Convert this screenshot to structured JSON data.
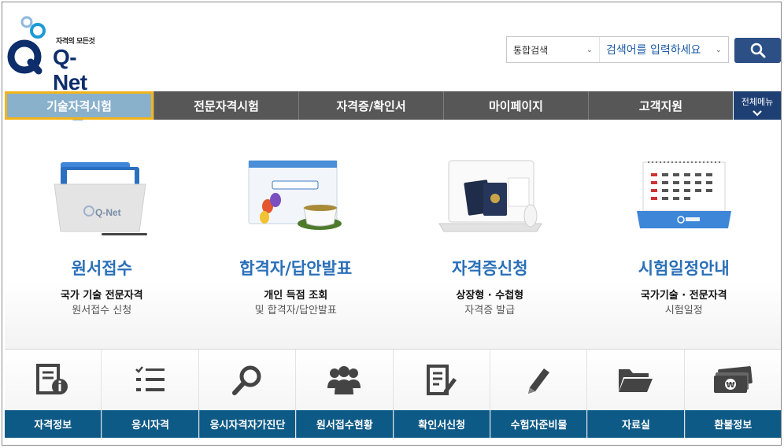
{
  "logo": {
    "tagline": "자격의 모든것",
    "text": "Q-Net"
  },
  "search": {
    "category": "통합검색",
    "placeholder": "검색어를 입력하세요"
  },
  "nav": {
    "items": [
      {
        "label": "기술자격시험"
      },
      {
        "label": "전문자격시험"
      },
      {
        "label": "자격증/확인서"
      },
      {
        "label": "마이페이지"
      },
      {
        "label": "고객지원"
      }
    ],
    "all_menu": "전체메뉴"
  },
  "features": [
    {
      "title": "원서접수",
      "sub": "국가 기술 전문자격",
      "sub2": "원서접수 신청",
      "icon": "folder-icon"
    },
    {
      "title": "합격자/답안발표",
      "sub": "개인 득점 조회",
      "sub2": "및 합격자/답안발표",
      "icon": "browser-tea-icon"
    },
    {
      "title": "자격증신청",
      "sub": "상장형 · 수첩형",
      "sub2": "자격증 발급",
      "icon": "certificate-laptop-icon"
    },
    {
      "title": "시험일정안내",
      "sub": "국가기술 · 전문자격",
      "sub2": "시험일정",
      "icon": "calendar-icon"
    }
  ],
  "quick_menu": [
    {
      "label": "자격정보",
      "icon": "document-info-icon"
    },
    {
      "label": "응시자격",
      "icon": "checklist-icon"
    },
    {
      "label": "응시자격자가진단",
      "icon": "magnifier-icon"
    },
    {
      "label": "원서접수현황",
      "icon": "people-icon"
    },
    {
      "label": "확인서신청",
      "icon": "document-edit-icon"
    },
    {
      "label": "수험자준비물",
      "icon": "pencil-icon"
    },
    {
      "label": "자료실",
      "icon": "folder-open-icon"
    },
    {
      "label": "환불정보",
      "icon": "money-icon"
    }
  ],
  "colors": {
    "nav_bg": "#575757",
    "nav_active": "#8ab1cc",
    "nav_active_border": "#f3b41a",
    "brand_blue": "#2a6fb8",
    "quick_label_bg": "#0e5a86",
    "search_btn": "#2c4f86"
  }
}
